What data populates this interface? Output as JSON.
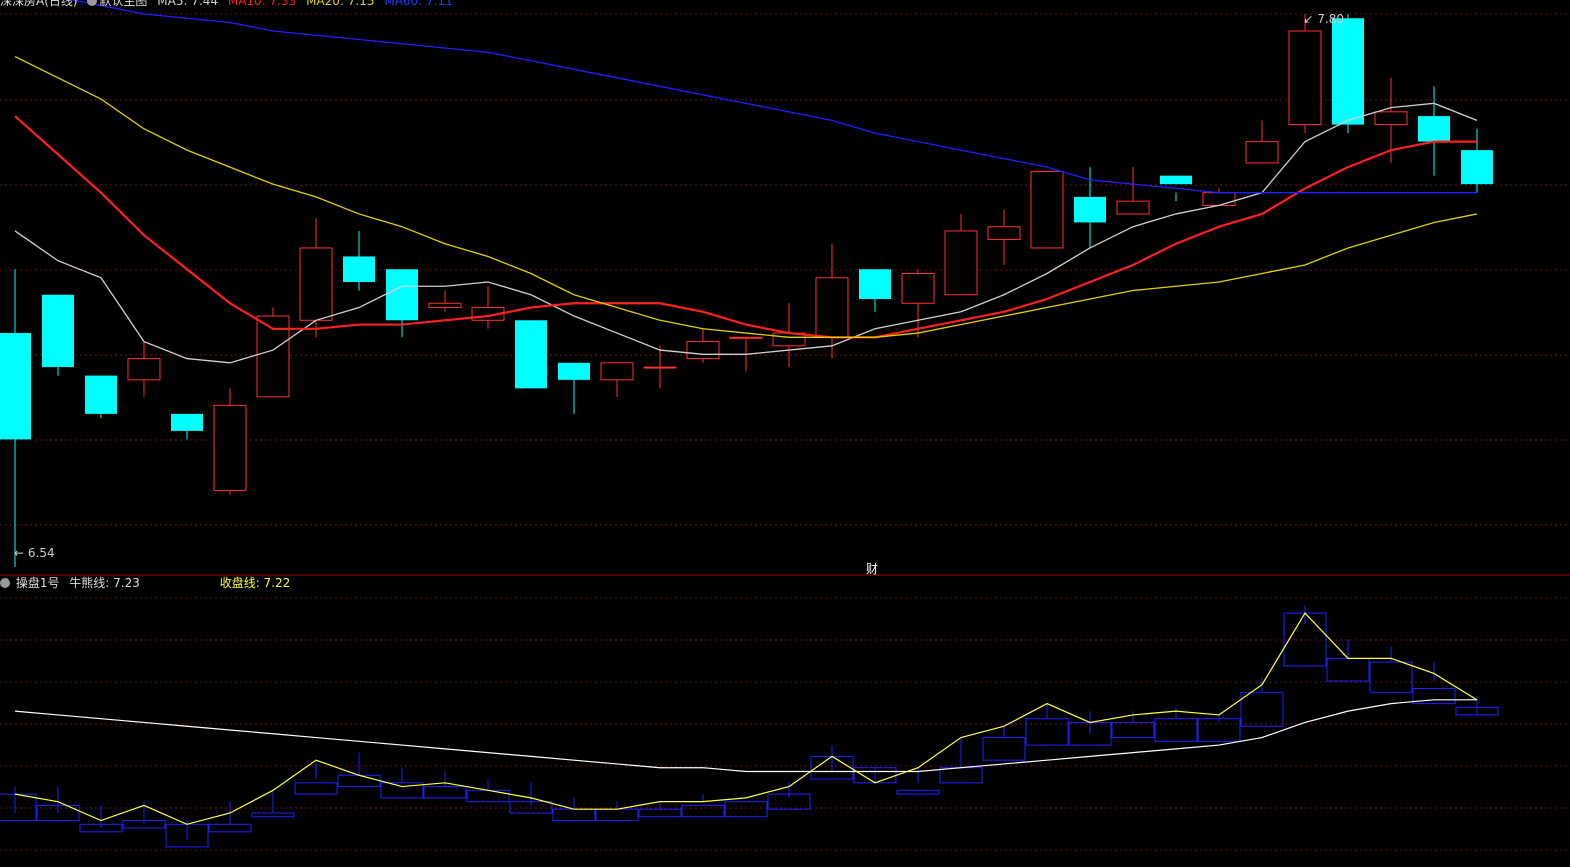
{
  "colors": {
    "up": "#ff3030",
    "down": "#00ffff",
    "ma5": "#d0d0d0",
    "ma10": "#ff2020",
    "ma20": "#e0d000",
    "ma60": "#2020ff",
    "grid": "#7a1010",
    "bull": "#ffffff",
    "close": "#ffff40",
    "boxUp": "#ff0000",
    "boxDown": "#2020ff"
  },
  "header": {
    "title": "深深房A(日线)",
    "indicator": "默认主图",
    "ma5": "MA5: 7.44",
    "ma10": "MA10: 7.33",
    "ma20": "MA20: 7.15",
    "ma60": "MA60: 7.11"
  },
  "labels": {
    "high": "7.80",
    "low": "6.54",
    "marker": "财"
  },
  "indicator_header": {
    "name": "操盘1号",
    "bull": "牛熊线: 7.23",
    "close": "收盘线: 7.22"
  },
  "chart_data": [
    {
      "type": "candlestick",
      "ylim": [
        6.54,
        7.8
      ],
      "high_label": "7.80",
      "low_label": "6.54",
      "candles": [
        [
          7.05,
          7.2,
          6.5,
          6.8
        ],
        [
          7.14,
          7.14,
          6.95,
          6.97
        ],
        [
          6.95,
          6.95,
          6.85,
          6.86
        ],
        [
          6.94,
          7.03,
          6.9,
          6.99
        ],
        [
          6.86,
          6.86,
          6.8,
          6.82
        ],
        [
          6.68,
          6.92,
          6.67,
          6.88
        ],
        [
          6.9,
          7.11,
          6.9,
          7.09
        ],
        [
          7.08,
          7.32,
          7.04,
          7.25
        ],
        [
          7.23,
          7.29,
          7.15,
          7.17
        ],
        [
          7.2,
          7.2,
          7.04,
          7.08
        ],
        [
          7.11,
          7.15,
          7.1,
          7.12
        ],
        [
          7.08,
          7.16,
          7.06,
          7.11
        ],
        [
          7.08,
          7.08,
          7.0,
          6.92
        ],
        [
          6.98,
          6.98,
          6.86,
          6.94
        ],
        [
          6.94,
          6.98,
          6.9,
          6.98
        ],
        [
          6.97,
          7.02,
          6.92,
          6.97
        ],
        [
          6.99,
          7.06,
          6.98,
          7.03
        ],
        [
          7.04,
          7.04,
          6.96,
          7.04
        ],
        [
          7.02,
          7.12,
          6.97,
          7.05
        ],
        [
          7.04,
          7.26,
          6.99,
          7.18
        ],
        [
          7.2,
          7.2,
          7.1,
          7.13
        ],
        [
          7.12,
          7.2,
          7.04,
          7.19
        ],
        [
          7.14,
          7.33,
          7.14,
          7.29
        ],
        [
          7.27,
          7.34,
          7.21,
          7.3
        ],
        [
          7.25,
          7.39,
          7.25,
          7.43
        ],
        [
          7.37,
          7.44,
          7.25,
          7.31
        ],
        [
          7.33,
          7.44,
          7.33,
          7.36
        ],
        [
          7.42,
          7.38,
          7.36,
          7.4
        ],
        [
          7.35,
          7.39,
          7.35,
          7.38
        ],
        [
          7.45,
          7.55,
          7.45,
          7.5
        ],
        [
          7.54,
          7.8,
          7.52,
          7.76
        ],
        [
          7.79,
          7.8,
          7.52,
          7.54
        ],
        [
          7.54,
          7.65,
          7.45,
          7.57
        ],
        [
          7.56,
          7.63,
          7.42,
          7.5
        ],
        [
          7.48,
          7.53,
          7.38,
          7.4
        ]
      ],
      "series": [
        {
          "name": "MA5",
          "values": [
            7.29,
            7.22,
            7.18,
            7.03,
            6.99,
            6.98,
            7.01,
            7.08,
            7.11,
            7.16,
            7.16,
            7.17,
            7.14,
            7.09,
            7.05,
            7.01,
            7.0,
            7.0,
            7.01,
            7.02,
            7.06,
            7.08,
            7.1,
            7.14,
            7.19,
            7.25,
            7.3,
            7.33,
            7.35,
            7.38,
            7.5,
            7.55,
            7.58,
            7.59,
            7.55
          ]
        },
        {
          "name": "MA10",
          "values": [
            7.56,
            7.47,
            7.38,
            7.28,
            7.2,
            7.12,
            7.06,
            7.06,
            7.07,
            7.07,
            7.08,
            7.09,
            7.11,
            7.12,
            7.12,
            7.12,
            7.1,
            7.07,
            7.05,
            7.04,
            7.04,
            7.06,
            7.08,
            7.1,
            7.13,
            7.17,
            7.21,
            7.26,
            7.3,
            7.33,
            7.39,
            7.44,
            7.48,
            7.5,
            7.5
          ]
        },
        {
          "name": "MA20",
          "values": [
            7.7,
            7.65,
            7.6,
            7.53,
            7.48,
            7.44,
            7.4,
            7.37,
            7.33,
            7.3,
            7.26,
            7.23,
            7.19,
            7.14,
            7.11,
            7.08,
            7.06,
            7.05,
            7.04,
            7.04,
            7.04,
            7.05,
            7.07,
            7.09,
            7.11,
            7.13,
            7.15,
            7.16,
            7.17,
            7.19,
            7.21,
            7.25,
            7.28,
            7.31,
            7.33
          ]
        },
        {
          "name": "MA60",
          "values": [
            7.85,
            7.84,
            7.82,
            7.8,
            7.79,
            7.78,
            7.76,
            7.75,
            7.74,
            7.73,
            7.72,
            7.71,
            7.69,
            7.67,
            7.65,
            7.63,
            7.61,
            7.59,
            7.57,
            7.55,
            7.52,
            7.5,
            7.48,
            7.46,
            7.44,
            7.41,
            7.4,
            7.39,
            7.38,
            7.38,
            7.38,
            7.38,
            7.38,
            7.38,
            7.38
          ]
        }
      ]
    },
    {
      "type": "box-indicator",
      "title": "操盘1号",
      "bars": [
        [
          6.9,
          6.92,
          6.85,
          6.83
        ],
        [
          6.87,
          6.92,
          6.85,
          6.83
        ],
        [
          6.82,
          6.87,
          6.81,
          6.8
        ],
        [
          6.83,
          6.88,
          6.82,
          6.81
        ],
        [
          6.82,
          6.83,
          6.78,
          6.76
        ],
        [
          6.82,
          6.88,
          6.82,
          6.8
        ],
        [
          6.85,
          6.91,
          6.85,
          6.84
        ],
        [
          6.93,
          6.99,
          6.94,
          6.9
        ],
        [
          6.95,
          7.01,
          6.95,
          6.92
        ],
        [
          6.93,
          6.97,
          6.93,
          6.89
        ],
        [
          6.92,
          6.96,
          6.92,
          6.89
        ],
        [
          6.91,
          6.94,
          6.91,
          6.88
        ],
        [
          6.88,
          6.93,
          6.87,
          6.85
        ],
        [
          6.86,
          6.89,
          6.86,
          6.83
        ],
        [
          6.86,
          6.88,
          6.86,
          6.83
        ],
        [
          6.86,
          6.88,
          6.86,
          6.84
        ],
        [
          6.87,
          6.9,
          6.88,
          6.84
        ],
        [
          6.88,
          6.88,
          6.88,
          6.84
        ],
        [
          6.9,
          6.93,
          6.89,
          6.86
        ],
        [
          7.0,
          7.03,
          6.96,
          6.94
        ],
        [
          6.97,
          6.97,
          6.93,
          6.93
        ],
        [
          6.91,
          6.97,
          6.93,
          6.9
        ],
        [
          6.97,
          7.05,
          6.97,
          6.93
        ],
        [
          7.05,
          7.08,
          7.05,
          6.99
        ],
        [
          7.1,
          7.14,
          7.1,
          7.03
        ],
        [
          7.09,
          7.12,
          7.06,
          7.03
        ],
        [
          7.09,
          7.12,
          7.09,
          7.05
        ],
        [
          7.1,
          7.13,
          7.1,
          7.04
        ],
        [
          7.1,
          7.11,
          7.09,
          7.04
        ],
        [
          7.17,
          7.21,
          7.17,
          7.08
        ],
        [
          7.38,
          7.4,
          7.35,
          7.24
        ],
        [
          7.26,
          7.31,
          7.26,
          7.2
        ],
        [
          7.25,
          7.29,
          7.25,
          7.17
        ],
        [
          7.18,
          7.25,
          7.2,
          7.14
        ],
        [
          7.13,
          7.16,
          7.11,
          7.11
        ]
      ],
      "series": [
        {
          "name": "牛熊线",
          "values": [
            7.12,
            7.11,
            7.1,
            7.09,
            7.08,
            7.07,
            7.06,
            7.05,
            7.04,
            7.03,
            7.02,
            7.01,
            7.0,
            6.99,
            6.98,
            6.97,
            6.97,
            6.96,
            6.96,
            6.96,
            6.96,
            6.96,
            6.97,
            6.98,
            6.99,
            7.0,
            7.01,
            7.02,
            7.03,
            7.05,
            7.09,
            7.12,
            7.14,
            7.15,
            7.15
          ]
        },
        {
          "name": "收盘线",
          "values": [
            6.9,
            6.88,
            6.83,
            6.87,
            6.82,
            6.85,
            6.91,
            6.99,
            6.95,
            6.92,
            6.93,
            6.91,
            6.89,
            6.86,
            6.86,
            6.88,
            6.88,
            6.89,
            6.92,
            7.0,
            6.93,
            6.97,
            7.05,
            7.08,
            7.14,
            7.09,
            7.11,
            7.12,
            7.11,
            7.19,
            7.38,
            7.26,
            7.26,
            7.22,
            7.15
          ]
        }
      ]
    }
  ]
}
